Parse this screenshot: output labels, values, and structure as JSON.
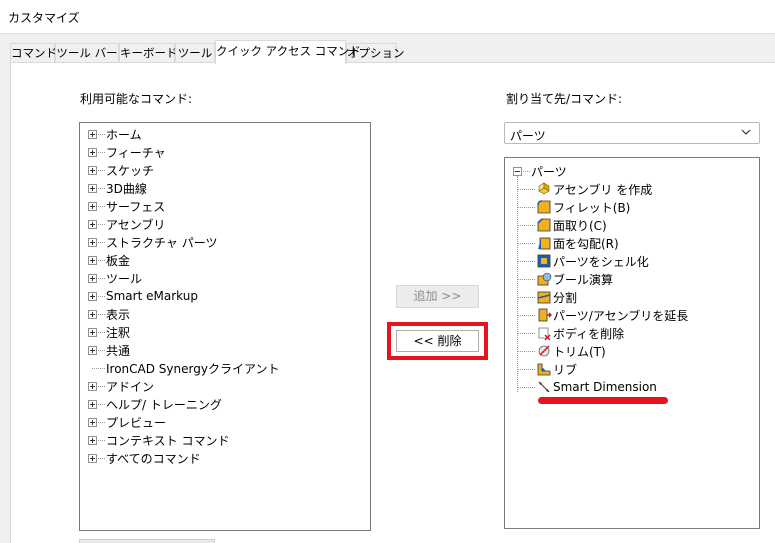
{
  "window": {
    "title": "カスタマイズ"
  },
  "tabs": [
    {
      "label": "コマンド"
    },
    {
      "label": "ツール バー"
    },
    {
      "label": "キーボード"
    },
    {
      "label": "ツール"
    },
    {
      "label": "クイック アクセス コマンド",
      "active": true
    },
    {
      "label": "オプション"
    }
  ],
  "left_panel": {
    "label": "利用可能なコマンド:",
    "items": [
      {
        "label": "ホーム",
        "expandable": true
      },
      {
        "label": "フィーチャ",
        "expandable": true
      },
      {
        "label": "スケッチ",
        "expandable": true
      },
      {
        "label": "3D曲線",
        "expandable": true
      },
      {
        "label": "サーフェス",
        "expandable": true
      },
      {
        "label": "アセンブリ",
        "expandable": true
      },
      {
        "label": "ストラクチャ パーツ",
        "expandable": true
      },
      {
        "label": "板金",
        "expandable": true
      },
      {
        "label": "ツール",
        "expandable": true
      },
      {
        "label": "Smart eMarkup",
        "expandable": true
      },
      {
        "label": "表示",
        "expandable": true
      },
      {
        "label": "注釈",
        "expandable": true
      },
      {
        "label": "共通",
        "expandable": true
      },
      {
        "label": "IronCAD Synergyクライアント",
        "expandable": false
      },
      {
        "label": "アドイン",
        "expandable": true
      },
      {
        "label": "ヘルプ/ トレーニング",
        "expandable": true
      },
      {
        "label": "プレビュー",
        "expandable": true
      },
      {
        "label": "コンテキスト コマンド",
        "expandable": true
      },
      {
        "label": "すべてのコマンド",
        "expandable": true
      }
    ]
  },
  "buttons": {
    "add": "追加 >>",
    "remove": "<< 削除"
  },
  "right_panel": {
    "label": "割り当て先/コマンド:",
    "dropdown_value": "パーツ",
    "root": "パーツ",
    "items": [
      {
        "label": "アセンブリ を作成",
        "icon": "create-assembly-icon"
      },
      {
        "label": "フィレット(B)",
        "icon": "fillet-icon"
      },
      {
        "label": "面取り(C)",
        "icon": "chamfer-icon"
      },
      {
        "label": "面を勾配(R)",
        "icon": "face-draft-icon"
      },
      {
        "label": "パーツをシェル化",
        "icon": "shell-icon"
      },
      {
        "label": "ブール演算",
        "icon": "boolean-icon"
      },
      {
        "label": "分割",
        "icon": "split-icon"
      },
      {
        "label": "パーツ/アセンブリを延長",
        "icon": "extend-icon"
      },
      {
        "label": "ボディを削除",
        "icon": "delete-body-icon"
      },
      {
        "label": "トリム(T)",
        "icon": "trim-icon"
      },
      {
        "label": "リブ",
        "icon": "rib-icon"
      },
      {
        "label": "Smart Dimension",
        "icon": "smart-dimension-icon"
      }
    ]
  },
  "highlight_color": "#e8141d"
}
